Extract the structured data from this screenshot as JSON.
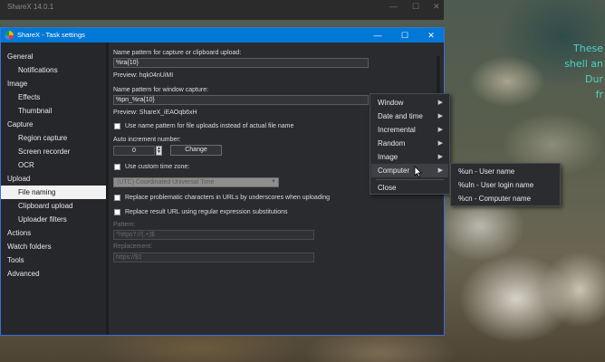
{
  "background_window": {
    "title": "ShareX 14.0.1"
  },
  "background_text": [
    "These",
    "shell an",
    "Dur",
    "fr"
  ],
  "window": {
    "title": "ShareX - Task settings",
    "controls": {
      "minimize": "—",
      "maximize": "☐",
      "close": "✕"
    }
  },
  "sidebar": {
    "items": [
      {
        "label": "General",
        "level": 1
      },
      {
        "label": "Notifications",
        "level": 2
      },
      {
        "label": "Image",
        "level": 1
      },
      {
        "label": "Effects",
        "level": 2
      },
      {
        "label": "Thumbnail",
        "level": 2
      },
      {
        "label": "Capture",
        "level": 1
      },
      {
        "label": "Region capture",
        "level": 2
      },
      {
        "label": "Screen recorder",
        "level": 2
      },
      {
        "label": "OCR",
        "level": 2
      },
      {
        "label": "Upload",
        "level": 1
      },
      {
        "label": "File naming",
        "level": 2,
        "selected": true
      },
      {
        "label": "Clipboard upload",
        "level": 2
      },
      {
        "label": "Uploader filters",
        "level": 2
      },
      {
        "label": "Actions",
        "level": 1
      },
      {
        "label": "Watch folders",
        "level": 1
      },
      {
        "label": "Tools",
        "level": 1
      },
      {
        "label": "Advanced",
        "level": 1
      }
    ]
  },
  "file_naming": {
    "name_pattern_label": "Name pattern for capture or clipboard upload:",
    "name_pattern_value": "%ra{10}",
    "name_pattern_preview": "Preview: hqk04nUiMI",
    "window_pattern_label": "Name pattern for window capture:",
    "window_pattern_value": "%pn_%ra{10}",
    "window_pattern_preview": "Preview: ShareX_iEAOqb6xH",
    "use_name_pattern_label": "Use name pattern for file uploads instead of actual file name",
    "auto_increment_label": "Auto increment number:",
    "auto_increment_value": "0",
    "change_button": "Change",
    "custom_time_zone_label": "Use custom time zone:",
    "time_zone_value": "(UTC) Coordinated Universal Time",
    "replace_chars_label": "Replace problematic characters in URLs by underscores when uploading",
    "replace_url_regex_label": "Replace result URL using regular expression substitutions",
    "pattern_label": "Pattern:",
    "pattern_value": "^https?://(.+)$",
    "replacement_label": "Replacement:",
    "replacement_value": "https://$1"
  },
  "context_menu": {
    "items": [
      "Window",
      "Date and time",
      "Incremental",
      "Random",
      "Image",
      "Computer",
      "Close"
    ],
    "has_submenu": [
      true,
      true,
      true,
      true,
      true,
      true,
      false
    ],
    "highlighted": "Computer"
  },
  "submenu": {
    "items": [
      "%un - User name",
      "%uln - User login name",
      "%cn - Computer name"
    ]
  },
  "colors": {
    "accent": "#0078d7",
    "selected_bg": "#f2f2f2",
    "teal_text": "#4fd1c6"
  }
}
